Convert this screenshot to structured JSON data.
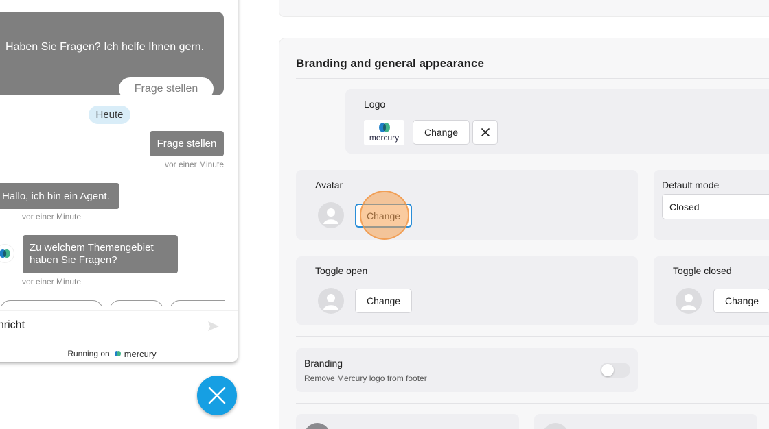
{
  "chat": {
    "welcome_text": "Haben Sie Fragen? Ich helfe Ihnen gern.",
    "ask_button": "Frage stellen",
    "date_label": "Heute",
    "messages": [
      {
        "text": "Frage stellen",
        "time": "vor einer Minute"
      },
      {
        "text": "Hallo, ich bin ein Agent.",
        "time": "vor einer Minute"
      },
      {
        "text": "Zu welchem Themengebiet haben Sie Fragen?",
        "time": "vor einer Minute"
      }
    ],
    "input_value": "achricht",
    "footer_prefix": "Running on",
    "footer_brand": "mercury"
  },
  "settings": {
    "section_title": "Branding and general appearance",
    "logo": {
      "label": "Logo",
      "brand_word": "mercury",
      "change_label": "Change"
    },
    "avatar": {
      "label": "Avatar",
      "change_label": "Change"
    },
    "default_mode": {
      "label": "Default mode",
      "value": "Closed"
    },
    "toggle_open": {
      "label": "Toggle open",
      "change_label": "Change"
    },
    "toggle_closed": {
      "label": "Toggle closed",
      "change_label": "Change"
    },
    "branding": {
      "label": "Branding",
      "description": "Remove Mercury logo from footer",
      "enabled": false
    }
  },
  "colors": {
    "accent": "#169fe3",
    "bubble": "#7f7f7f",
    "card": "#f7f7f8",
    "logo_green": "#3fb38a",
    "logo_blue": "#1e7fc8"
  }
}
